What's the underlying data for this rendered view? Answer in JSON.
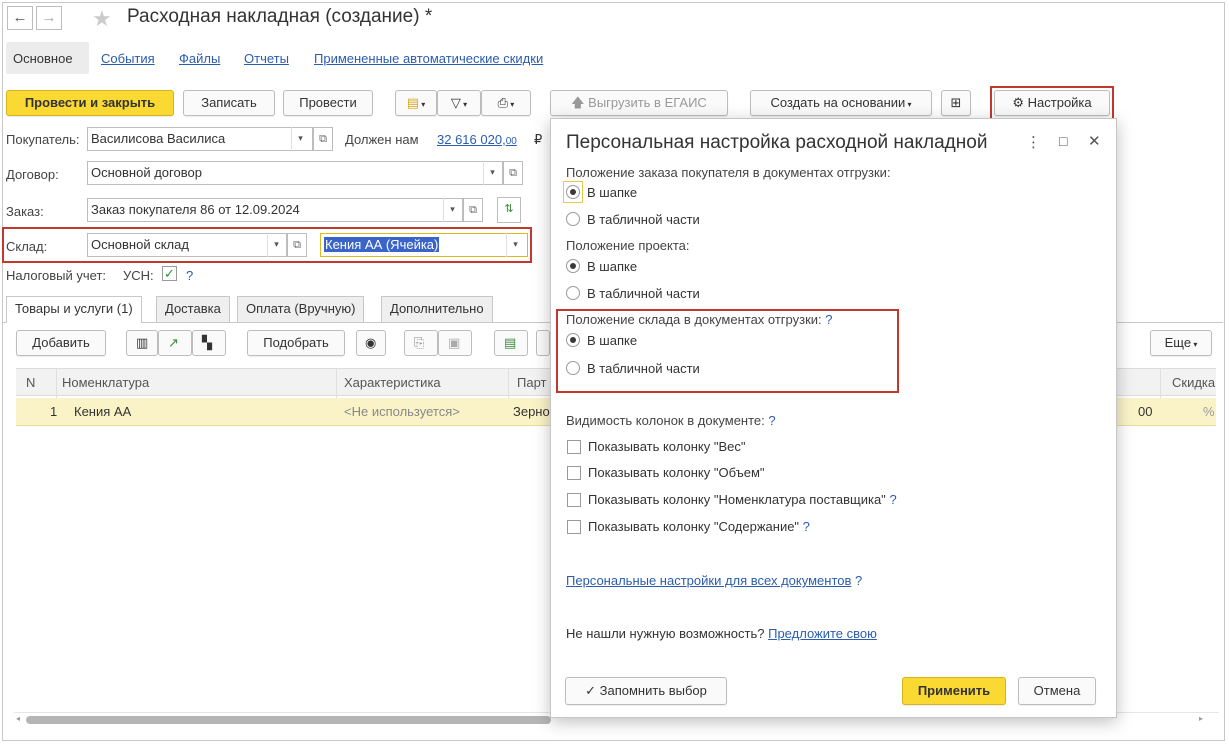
{
  "window": {
    "title": "Расходная накладная (создание) *",
    "back": "←",
    "forward": "→"
  },
  "nav_tabs": [
    "Основное",
    "События",
    "Файлы",
    "Отчеты",
    "Примененные автоматические скидки"
  ],
  "toolbar": {
    "post_close": "Провести и закрыть",
    "save": "Записать",
    "post": "Провести",
    "egais": "Выгрузить в ЕГАИС",
    "create_based": "Создать на основании",
    "settings": "Настройка"
  },
  "form": {
    "buyer_label": "Покупатель:",
    "buyer_value": "Василисова Василиса",
    "debt_text": "Должен нам",
    "debt_value": "32 616 020,",
    "debt_cents": "00",
    "currency": "₽",
    "contract_label": "Договор:",
    "contract_value": "Основной договор",
    "order_label": "Заказ:",
    "order_value": "Заказ покупателя 86 от 12.09.2024",
    "warehouse_label": "Склад:",
    "warehouse_value": "Основной склад",
    "cell_value": "Кения АА (Ячейка)",
    "tax_label": "Налоговый учет:",
    "tax_value": "УСН:",
    "tax_check": "✓",
    "q": "?"
  },
  "doc_tabs": [
    "Товары и услуги (1)",
    "Доставка",
    "Оплата (Вручную)",
    "Дополнительно"
  ],
  "table_toolbar": {
    "add": "Добавить",
    "pick": "Подобрать",
    "more": "Еще"
  },
  "table": {
    "headers": [
      "N",
      "Номенклатура",
      "Характеристика",
      "Парт",
      "Скидка"
    ],
    "row": {
      "n": "1",
      "item": "Кения АА",
      "characteristic": "<Не используется>",
      "batch": "Зерно",
      "amount_tail": "00",
      "discount_tail": "%"
    }
  },
  "dialog": {
    "title": "Персональная настройка расходной накладной",
    "menu_icon": "⋮",
    "max_icon": "□",
    "close_icon": "✕",
    "order_pos_label": "Положение заказа покупателя в документах отгрузки:",
    "project_pos_label": "Положение проекта:",
    "warehouse_pos_label": "Положение склада в документах отгрузки:",
    "opt_header": "В шапке",
    "opt_table": "В табличной части",
    "visibility_label": "Видимость колонок в документе:",
    "col_weight": "Показывать колонку \"Вес\"",
    "col_volume": "Показывать колонку \"Объем\"",
    "col_supplier": "Показывать колонку \"Номенклатура поставщика\"",
    "col_content": "Показывать колонку \"Содержание\"",
    "all_docs_link": "Персональные настройки для всех документов",
    "not_found": "Не нашли нужную возможность?",
    "suggest_link": "Предложите свою",
    "remember": "Запомнить выбор",
    "apply": "Применить",
    "cancel": "Отмена",
    "q": "?"
  },
  "colors": {
    "accent_yellow": "#fbd933",
    "highlight_red": "#c0392b",
    "link_blue": "#2a5db0",
    "row_selected": "#fbf3c8"
  }
}
